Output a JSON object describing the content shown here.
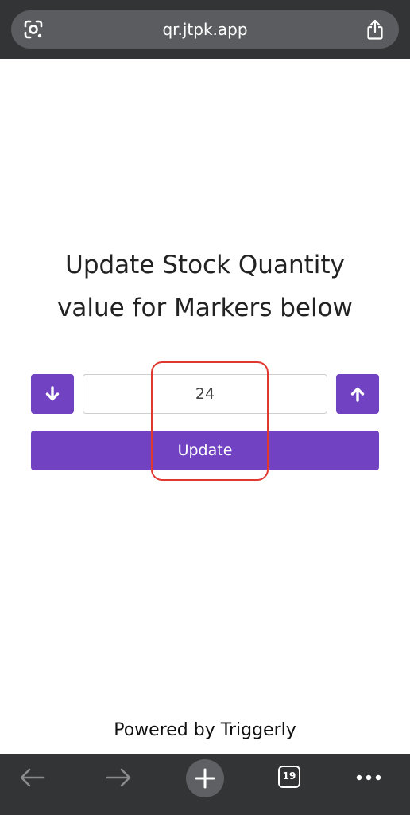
{
  "browser": {
    "url": "qr.jtpk.app",
    "tab_count": "19"
  },
  "main": {
    "heading_line1": "Update Stock Quantity",
    "heading_line2": "value for Markers below",
    "quantity_value": "24",
    "update_label": "Update"
  },
  "footer": {
    "powered_by": "Powered by Triggerly"
  },
  "icons": {
    "lens": "google-lens-icon",
    "share": "share-icon",
    "decrement": "arrow-down-icon",
    "increment": "arrow-up-icon",
    "back": "arrow-left-icon",
    "forward": "arrow-right-icon",
    "new_tab": "plus-icon",
    "tabs": "tabs-icon",
    "more": "more-icon"
  },
  "colors": {
    "accent": "#7143c2",
    "highlight": "#e0382f",
    "browser_chrome": "#333436"
  }
}
